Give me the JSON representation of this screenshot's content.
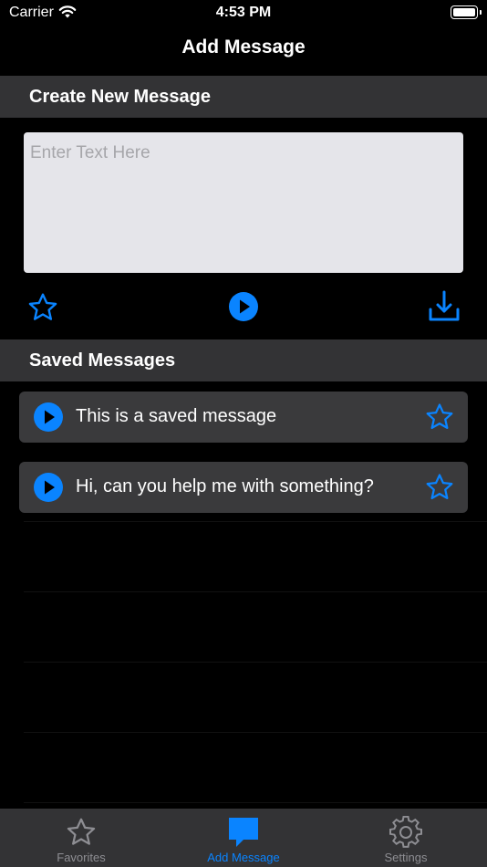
{
  "status_bar": {
    "carrier": "Carrier",
    "time": "4:53 PM"
  },
  "nav": {
    "title": "Add Message"
  },
  "create_section": {
    "header": "Create New Message",
    "input": {
      "placeholder": "Enter Text Here",
      "value": ""
    }
  },
  "toolbar": {
    "favorite_icon": "star-outline-icon",
    "play_icon": "play-circle-icon",
    "save_icon": "download-icon"
  },
  "saved_section": {
    "header": "Saved Messages",
    "messages": [
      {
        "text": "This is a saved message"
      },
      {
        "text": "Hi, can you help me with something?"
      }
    ]
  },
  "tabs": [
    {
      "label": "Favorites",
      "icon": "star-icon",
      "active": false
    },
    {
      "label": "Add Message",
      "icon": "message-bubble-icon",
      "active": true
    },
    {
      "label": "Settings",
      "icon": "gear-icon",
      "active": false
    }
  ],
  "colors": {
    "accent": "#0a84ff",
    "inactive": "#8e8e93",
    "header_bg": "#333335",
    "card_bg": "#3a3a3c",
    "input_bg": "#e5e5ea"
  }
}
